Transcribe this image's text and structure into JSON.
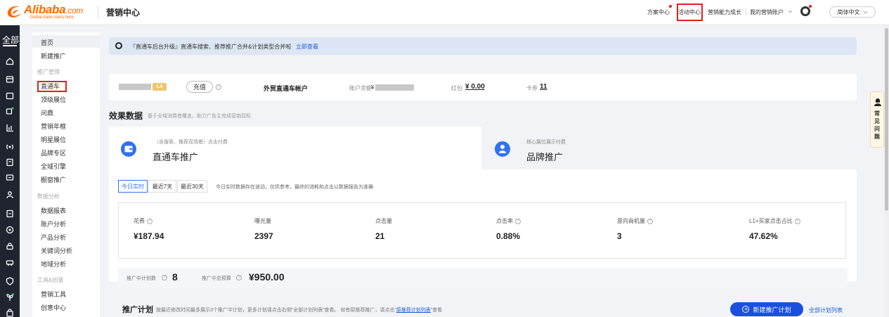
{
  "brand": {
    "logo_text": "Alibaba",
    "logo_suffix": ".com",
    "logo_tagline": "Global trade starts here.",
    "app_title": "营销中心"
  },
  "topnav": {
    "items": [
      "方案中心",
      "活动中心",
      "营销能力成长",
      "我的营销账户"
    ],
    "language": "简体中文",
    "accent": "#e02020"
  },
  "rail": {
    "all_label": "全部",
    "icons": [
      "home-icon",
      "store-icon",
      "wallet-icon",
      "video-icon",
      "chart-icon",
      "broadcast-icon",
      "clipboard-icon",
      "message-icon",
      "users-icon",
      "document-icon",
      "target-icon",
      "lock-icon",
      "car-icon",
      "shield-icon",
      "plant-icon",
      "bag-icon"
    ]
  },
  "sidebar": {
    "items_top": [
      "首页",
      "新建推广"
    ],
    "group_promo": "推广管理",
    "promo_items": [
      "直通车",
      "顶级展位",
      "问鼎",
      "营销年框",
      "明星展位",
      "品牌专区",
      "全域引擎",
      "橱窗推广"
    ],
    "group_analysis": "数据分析",
    "analysis_items": [
      "数据报表",
      "账户分析",
      "产品分析",
      "关键词分析",
      "地域分析"
    ],
    "group_tools": "工具&创意",
    "tools_items": [
      "营销工具",
      "创意中心"
    ],
    "active": "直通车"
  },
  "notice": {
    "text": "『直通车后台升级』直通车搜索、推荐推广合并&计划类型合并啦",
    "link": "立即查看"
  },
  "account": {
    "level": "L4",
    "recharge": "充值",
    "type": "外贸直通车帐户",
    "balance_label": "账户余额",
    "balance_prefix": "¥",
    "redpack_label": "红包",
    "redpack_value": "¥ 0.00",
    "card_label": "卡券",
    "card_value": "11"
  },
  "effect": {
    "title": "效果数据",
    "subtitle": "基于全域消费者覆盖，助力广告主完成营销目标"
  },
  "products": [
    {
      "sub": "（含搜索、推荐双场景）点击付费",
      "title": "直通车推广"
    },
    {
      "sub": "核心展位展示付费",
      "title": "品牌推广"
    }
  ],
  "ranges": {
    "options": [
      "今日实时",
      "最近7天",
      "最近30天"
    ],
    "active": "今日实时",
    "note": "今日实时数据存在波动，仅供参考，最终的消耗和点击以数据报告为准确"
  },
  "metrics": [
    {
      "label": "花费",
      "value": "¥187.94"
    },
    {
      "label": "曝光量",
      "value": "2397"
    },
    {
      "label": "点击量",
      "value": "21"
    },
    {
      "label": "点击率",
      "value": "0.88%"
    },
    {
      "label": "意向商机量",
      "value": "3"
    },
    {
      "label": "L1+买家点击占比",
      "value": "47.62%"
    }
  ],
  "budget": {
    "count_label": "推广中计划数",
    "count_value": "8",
    "total_label": "推广中总预算",
    "total_value": "¥950.00"
  },
  "plans": {
    "title": "推广计划",
    "subtitle": "按最近修改时间最多展示3个推广中计划，更多计划请点击右侧“全部计划列表”查看。 如有原推荐推广，请点击“",
    "subtitle_link": "原推荐计划列表",
    "subtitle_end": "”查看",
    "new_button": "新建推广计划",
    "all_link": "全部计划列表"
  },
  "faq": {
    "label": "常见问题"
  }
}
